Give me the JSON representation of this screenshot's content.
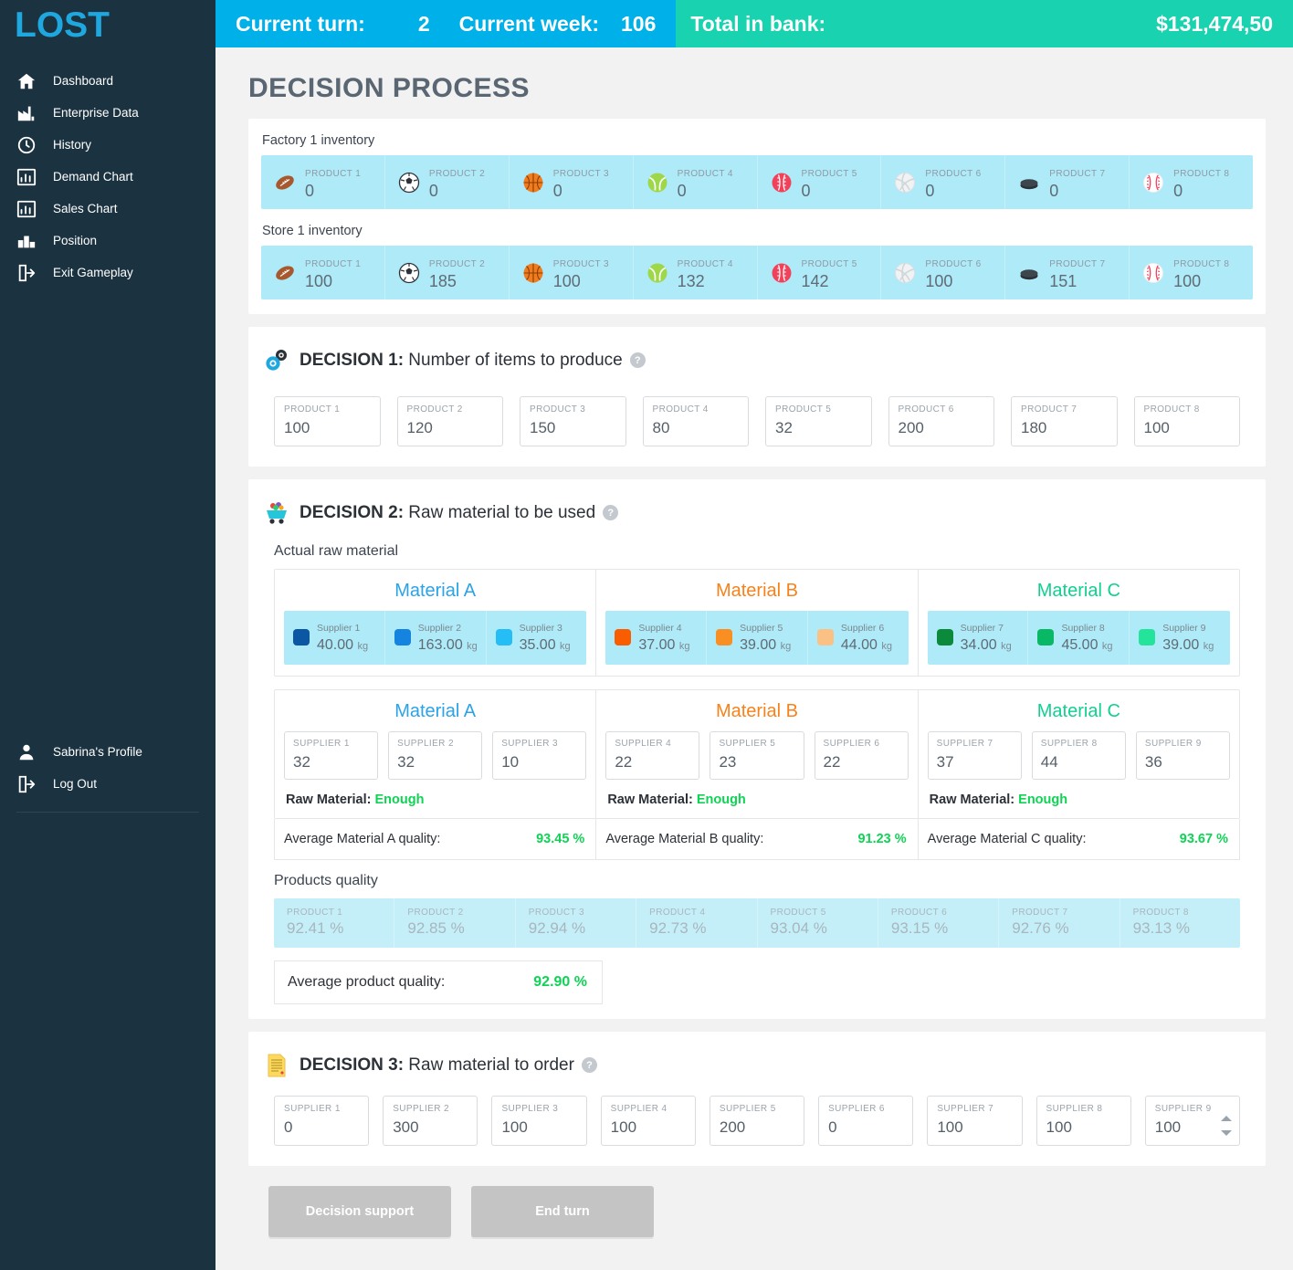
{
  "sidebar": {
    "brand": "LOST",
    "items": [
      {
        "label": "Dashboard",
        "icon": "home-icon"
      },
      {
        "label": "Enterprise Data",
        "icon": "factory-icon"
      },
      {
        "label": "History",
        "icon": "clock-history-icon"
      },
      {
        "label": "Demand Chart",
        "icon": "bar-chart-icon"
      },
      {
        "label": "Sales Chart",
        "icon": "bar-chart-icon"
      },
      {
        "label": "Position",
        "icon": "podium-icon"
      },
      {
        "label": "Exit Gameplay",
        "icon": "exit-icon"
      }
    ],
    "bottom_items": [
      {
        "label": "Sabrina's Profile",
        "icon": "user-icon"
      },
      {
        "label": "Log Out",
        "icon": "logout-icon"
      }
    ]
  },
  "topbar": {
    "turn_label": "Current turn:",
    "turn_value": "2",
    "week_label": "Current week:",
    "week_value": "106",
    "bank_label": "Total in bank:",
    "bank_value": "$131,474,50"
  },
  "page_title": "DECISION PROCESS",
  "inventory": {
    "factory_title": "Factory 1 inventory",
    "store_title": "Store 1 inventory",
    "factory": [
      {
        "name": "PRODUCT 1",
        "value": "0",
        "icon": "football-icon"
      },
      {
        "name": "PRODUCT 2",
        "value": "0",
        "icon": "soccer-ball-icon"
      },
      {
        "name": "PRODUCT 3",
        "value": "0",
        "icon": "basketball-icon"
      },
      {
        "name": "PRODUCT 4",
        "value": "0",
        "icon": "tennis-ball-icon"
      },
      {
        "name": "PRODUCT 5",
        "value": "0",
        "icon": "cricket-ball-icon"
      },
      {
        "name": "PRODUCT 6",
        "value": "0",
        "icon": "volleyball-icon"
      },
      {
        "name": "PRODUCT 7",
        "value": "0",
        "icon": "hockey-puck-icon"
      },
      {
        "name": "PRODUCT 8",
        "value": "0",
        "icon": "baseball-icon"
      }
    ],
    "store": [
      {
        "name": "PRODUCT 1",
        "value": "100",
        "icon": "football-icon"
      },
      {
        "name": "PRODUCT 2",
        "value": "185",
        "icon": "soccer-ball-icon"
      },
      {
        "name": "PRODUCT 3",
        "value": "100",
        "icon": "basketball-icon"
      },
      {
        "name": "PRODUCT 4",
        "value": "132",
        "icon": "tennis-ball-icon"
      },
      {
        "name": "PRODUCT 5",
        "value": "142",
        "icon": "cricket-ball-icon"
      },
      {
        "name": "PRODUCT 6",
        "value": "100",
        "icon": "volleyball-icon"
      },
      {
        "name": "PRODUCT 7",
        "value": "151",
        "icon": "hockey-puck-icon"
      },
      {
        "name": "PRODUCT 8",
        "value": "100",
        "icon": "baseball-icon"
      }
    ]
  },
  "decision1": {
    "number": "DECISION 1:",
    "title": " Number of items to produce",
    "icon": "gears-icon",
    "help": "?",
    "fields": [
      {
        "label": "PRODUCT 1",
        "value": "100"
      },
      {
        "label": "PRODUCT 2",
        "value": "120"
      },
      {
        "label": "PRODUCT 3",
        "value": "150"
      },
      {
        "label": "PRODUCT 4",
        "value": "80"
      },
      {
        "label": "PRODUCT 5",
        "value": "32"
      },
      {
        "label": "PRODUCT 6",
        "value": "200"
      },
      {
        "label": "PRODUCT 7",
        "value": "180"
      },
      {
        "label": "PRODUCT 8",
        "value": "100"
      }
    ]
  },
  "decision2": {
    "number": "DECISION 2:",
    "title": " Raw material to be used",
    "icon": "mine-cart-icon",
    "help": "?",
    "actual_title": "Actual raw material",
    "materials": [
      {
        "name": "Material A",
        "color": "#2aa3e8",
        "suppliers": [
          {
            "name": "Supplier 1",
            "amount": "40.00",
            "unit": "kg",
            "color": "#0b57a4"
          },
          {
            "name": "Supplier 2",
            "amount": "163.00",
            "unit": "kg",
            "color": "#1584e0"
          },
          {
            "name": "Supplier 3",
            "amount": "35.00",
            "unit": "kg",
            "color": "#25bdf5"
          }
        ]
      },
      {
        "name": "Material B",
        "color": "#f7821b",
        "suppliers": [
          {
            "name": "Supplier 4",
            "amount": "37.00",
            "unit": "kg",
            "color": "#fa5c00"
          },
          {
            "name": "Supplier 5",
            "amount": "39.00",
            "unit": "kg",
            "color": "#f98f23"
          },
          {
            "name": "Supplier 6",
            "amount": "44.00",
            "unit": "kg",
            "color": "#fbc083"
          }
        ]
      },
      {
        "name": "Material C",
        "color": "#12cf92",
        "suppliers": [
          {
            "name": "Supplier 7",
            "amount": "34.00",
            "unit": "kg",
            "color": "#0c8a3c"
          },
          {
            "name": "Supplier 8",
            "amount": "45.00",
            "unit": "kg",
            "color": "#09b865"
          },
          {
            "name": "Supplier 9",
            "amount": "39.00",
            "unit": "kg",
            "color": "#24e39a"
          }
        ]
      }
    ],
    "usage": [
      {
        "name": "Material A",
        "color": "#2aa3e8",
        "fields": [
          {
            "label": "SUPPLIER 1",
            "value": "32"
          },
          {
            "label": "SUPPLIER 2",
            "value": "32"
          },
          {
            "label": "SUPPLIER 3",
            "value": "10"
          }
        ],
        "raw_label": "Raw Material: ",
        "raw_status": "Enough",
        "avg_label": "Average Material A quality:",
        "avg_value": "93.45 %"
      },
      {
        "name": "Material B",
        "color": "#f7821b",
        "fields": [
          {
            "label": "SUPPLIER 4",
            "value": "22"
          },
          {
            "label": "SUPPLIER 5",
            "value": "23"
          },
          {
            "label": "SUPPLIER 6",
            "value": "22"
          }
        ],
        "raw_label": "Raw Material: ",
        "raw_status": "Enough",
        "avg_label": "Average Material B quality:",
        "avg_value": "91.23 %"
      },
      {
        "name": "Material C",
        "color": "#12cf92",
        "fields": [
          {
            "label": "SUPPLIER 7",
            "value": "37"
          },
          {
            "label": "SUPPLIER 8",
            "value": "44"
          },
          {
            "label": "SUPPLIER 9",
            "value": "36"
          }
        ],
        "raw_label": "Raw Material: ",
        "raw_status": "Enough",
        "avg_label": "Average Material C quality:",
        "avg_value": "93.67 %"
      }
    ],
    "products_quality_title": "Products quality",
    "products_quality": [
      {
        "name": "PRODUCT 1",
        "value": "92.41 %"
      },
      {
        "name": "PRODUCT 2",
        "value": "92.85 %"
      },
      {
        "name": "PRODUCT 3",
        "value": "92.94 %"
      },
      {
        "name": "PRODUCT 4",
        "value": "92.73 %"
      },
      {
        "name": "PRODUCT 5",
        "value": "93.04 %"
      },
      {
        "name": "PRODUCT 6",
        "value": "93.15 %"
      },
      {
        "name": "PRODUCT 7",
        "value": "92.76 %"
      },
      {
        "name": "PRODUCT 8",
        "value": "93.13 %"
      }
    ],
    "avg_product_label": "Average product quality:",
    "avg_product_value": "92.90 %"
  },
  "decision3": {
    "number": "DECISION 3:",
    "title": " Raw material to order",
    "icon": "document-icon",
    "help": "?",
    "fields": [
      {
        "label": "SUPPLIER 1",
        "value": "0"
      },
      {
        "label": "SUPPLIER 2",
        "value": "300"
      },
      {
        "label": "SUPPLIER 3",
        "value": "100"
      },
      {
        "label": "SUPPLIER 4",
        "value": "100"
      },
      {
        "label": "SUPPLIER 5",
        "value": "200"
      },
      {
        "label": "SUPPLIER 6",
        "value": "0"
      },
      {
        "label": "SUPPLIER 7",
        "value": "100"
      },
      {
        "label": "SUPPLIER 8",
        "value": "100"
      },
      {
        "label": "SUPPLIER 9",
        "value": "100"
      }
    ]
  },
  "actions": {
    "decision_support": "Decision support",
    "end_turn": "End turn"
  },
  "colors": {
    "sidebar_bg": "#1b3240",
    "brand": "#1fa8e0",
    "topbar_blue": "#00b0e8",
    "topbar_teal": "#19d2b0",
    "inventory_bg": "#aeeaf7",
    "success": "#0fd354"
  }
}
